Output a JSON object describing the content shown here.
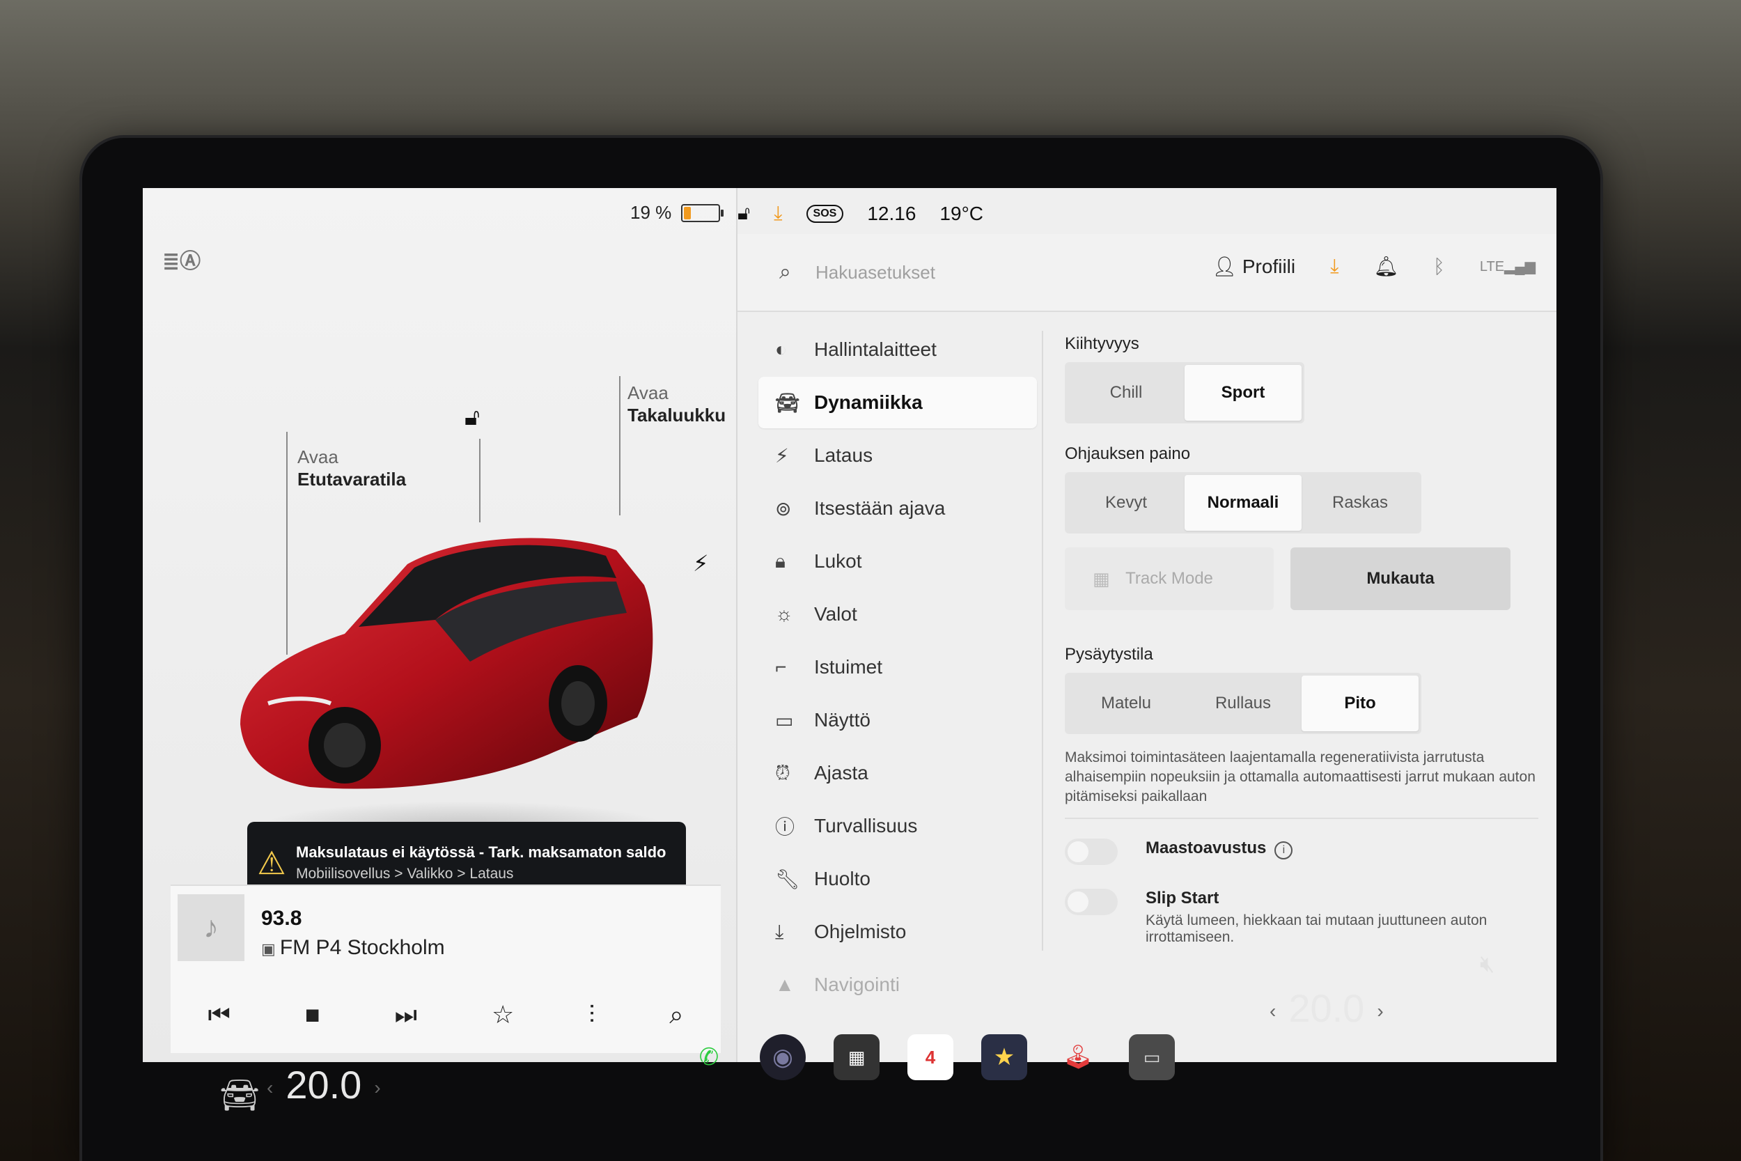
{
  "status": {
    "battery_percent_text": "19 %",
    "battery_level": 0.19,
    "time": "12.16",
    "temperature": "19°C",
    "sos": "SOS"
  },
  "car_panel": {
    "frunk": {
      "line1": "Avaa",
      "line2": "Etutavaratila"
    },
    "trunk": {
      "line1": "Avaa",
      "line2": "Takaluukku"
    },
    "car_color": "#b3101b"
  },
  "alert": {
    "title": "Maksulataus ei käytössä - Tark. maksamaton saldo",
    "subtitle": "Mobiilisovellus > Valikko > Lataus"
  },
  "media": {
    "frequency": "93.8",
    "station": "FM P4 Stockholm"
  },
  "topbar": {
    "search_placeholder": "Hakuasetukset",
    "profile_label": "Profiili"
  },
  "menu": [
    {
      "label": "Hallintalaitteet",
      "icon": "toggle-icon"
    },
    {
      "label": "Dynamiikka",
      "icon": "car-icon",
      "active": true
    },
    {
      "label": "Lataus",
      "icon": "bolt-icon"
    },
    {
      "label": "Itsestään ajava",
      "icon": "steering-wheel-icon"
    },
    {
      "label": "Lukot",
      "icon": "lock-icon"
    },
    {
      "label": "Valot",
      "icon": "sun-icon"
    },
    {
      "label": "Istuimet",
      "icon": "seat-icon"
    },
    {
      "label": "Näyttö",
      "icon": "display-icon"
    },
    {
      "label": "Ajasta",
      "icon": "alarm-icon"
    },
    {
      "label": "Turvallisuus",
      "icon": "info-icon"
    },
    {
      "label": "Huolto",
      "icon": "wrench-icon"
    },
    {
      "label": "Ohjelmisto",
      "icon": "download-icon"
    },
    {
      "label": "Navigointi",
      "icon": "navigation-icon"
    }
  ],
  "settings": {
    "acceleration": {
      "title": "Kiihtyvyys",
      "options": [
        "Chill",
        "Sport"
      ],
      "selected": "Sport"
    },
    "steering": {
      "title": "Ohjauksen paino",
      "options": [
        "Kevyt",
        "Normaali",
        "Raskas"
      ],
      "selected": "Normaali"
    },
    "track_mode": "Track Mode",
    "customize": "Mukauta",
    "stopping": {
      "title": "Pysäytystila",
      "options": [
        "Matelu",
        "Rullaus",
        "Pito"
      ],
      "selected": "Pito"
    },
    "stopping_desc": "Maksimoi toimintasäteen laajentamalla regeneratiivista jarrutusta alhaisempiin nopeuksiin ja ottamalla automaattisesti jarrut mukaan auton pitämiseksi paikallaan",
    "off_road": {
      "label": "Maastoavustus",
      "enabled": false
    },
    "slip_start": {
      "label": "Slip Start",
      "description": "Käytä lumeen, hiekkaan tai mutaan juuttuneen auton irrottamiseen.",
      "enabled": false
    }
  },
  "dock": {
    "driver_temp": "20.0",
    "passenger_temp": "20.0",
    "calendar_day": "4"
  },
  "colors": {
    "accent_orange": "#f19a1f",
    "phone_green": "#2ecc40",
    "alert_bg": "#15171a"
  }
}
